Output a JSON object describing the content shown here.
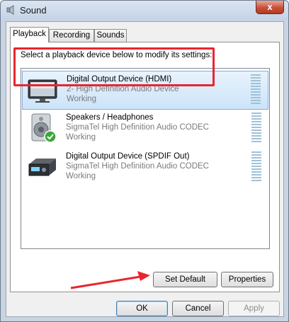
{
  "window": {
    "title": "Sound",
    "close_label": "x"
  },
  "tabs": [
    {
      "label": "Playback",
      "active": true
    },
    {
      "label": "Recording",
      "active": false
    },
    {
      "label": "Sounds",
      "active": false
    }
  ],
  "instruction": "Select a playback device below to modify its settings:",
  "devices": [
    {
      "name": "Digital Output Device (HDMI)",
      "description": "2- High Definition Audio Device",
      "status": "Working",
      "icon": "monitor-icon",
      "selected": true
    },
    {
      "name": "Speakers / Headphones",
      "description": "SigmaTel High Definition Audio CODEC",
      "status": "Working",
      "icon": "speaker-icon",
      "default": true
    },
    {
      "name": "Digital Output Device (SPDIF Out)",
      "description": "SigmaTel High Definition Audio CODEC",
      "status": "Working",
      "icon": "digital-receiver-icon"
    }
  ],
  "buttons": {
    "set_default": "Set Default",
    "properties": "Properties",
    "ok": "OK",
    "cancel": "Cancel",
    "apply": "Apply"
  },
  "colors": {
    "selection": "#cce4f9",
    "annotation_red": "#e8262f",
    "default_check": "#3aa63a"
  }
}
